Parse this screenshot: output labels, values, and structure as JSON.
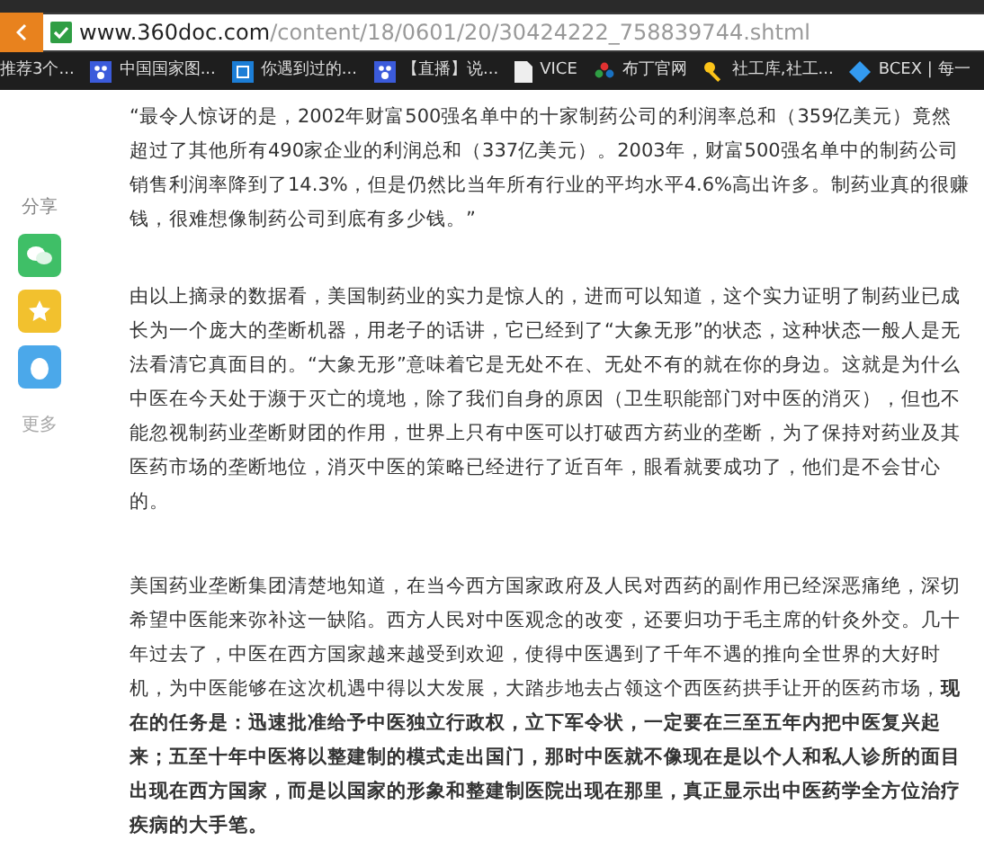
{
  "address_bar": {
    "domain": "www.360doc.com",
    "path": "/content/18/0601/20/30424222_758839744.shtml"
  },
  "bookmarks": [
    {
      "label": "推荐3个..."
    },
    {
      "label": "中国国家图..."
    },
    {
      "label": "你遇到过的..."
    },
    {
      "label": "【直播】说..."
    },
    {
      "label": "VICE"
    },
    {
      "label": "布丁官网"
    },
    {
      "label": "社工库,社工..."
    },
    {
      "label": "BCEX | 每一"
    }
  ],
  "share_sidebar": {
    "title": "分享",
    "buttons": [
      {
        "kind": "wechat"
      },
      {
        "kind": "favorite"
      },
      {
        "kind": "qzone"
      }
    ],
    "more": "更多"
  },
  "paragraphs": [
    "“最令人惊讶的是，2002年财富500强名单中的十家制药公司的利润率总和（359亿美元）竟然超过了其他所有490家企业的利润总和（337亿美元）。2003年，财富500强名单中的制药公司销售利润率降到了14.3%，但是仍然比当年所有行业的平均水平4.6%高出许多。制药业真的很赚钱，很难想像制药公司到底有多少钱。”",
    "由以上摘录的数据看，美国制药业的实力是惊人的，进而可以知道，这个实力证明了制药业已成长为一个庞大的垄断机器，用老子的话讲，它已经到了“大象无形”的状态，这种状态一般人是无法看清它真面目的。“大象无形”意味着它是无处不在、无处不有的就在你的身边。这就是为什么中医在今天处于濒于灭亡的境地，除了我们自身的原因（卫生职能部门对中医的消灭），但也不能忽视制药业垄断财团的作用，世界上只有中医可以打破西方药业的垄断，为了保持对药业及其医药市场的垄断地位，消灭中医的策略已经进行了近百年，眼看就要成功了，他们是不会甘心的。",
    "美国药业垄断集团清楚地知道，在当今西方国家政府及人民对西药的副作用已经深恶痛绝，深切希望中医能来弥补这一缺陷。西方人民对中医观念的改变，还要归功于毛主席的针灸外交。几十年过去了，中医在西方国家越来越受到欢迎，使得中医遇到了千年不遇的推向全世界的大好时机，为中医能够在这次机遇中得以大发展，大踏步地去占领这个西医药拱手让开的医药市场，**现在的任务是：迅速批准给予中医独立行政权，立下军令状，一定要在三至五年内把中医复兴起来；五至十年中医将以整建制的模式走出国门，那时中医就不像现在是以个人和私人诊所的面目出现在西方国家，而是以国家的形象和整建制医院出现在那里，真正显示出中医药学全方位治疗疾病的大手笔。**"
  ]
}
